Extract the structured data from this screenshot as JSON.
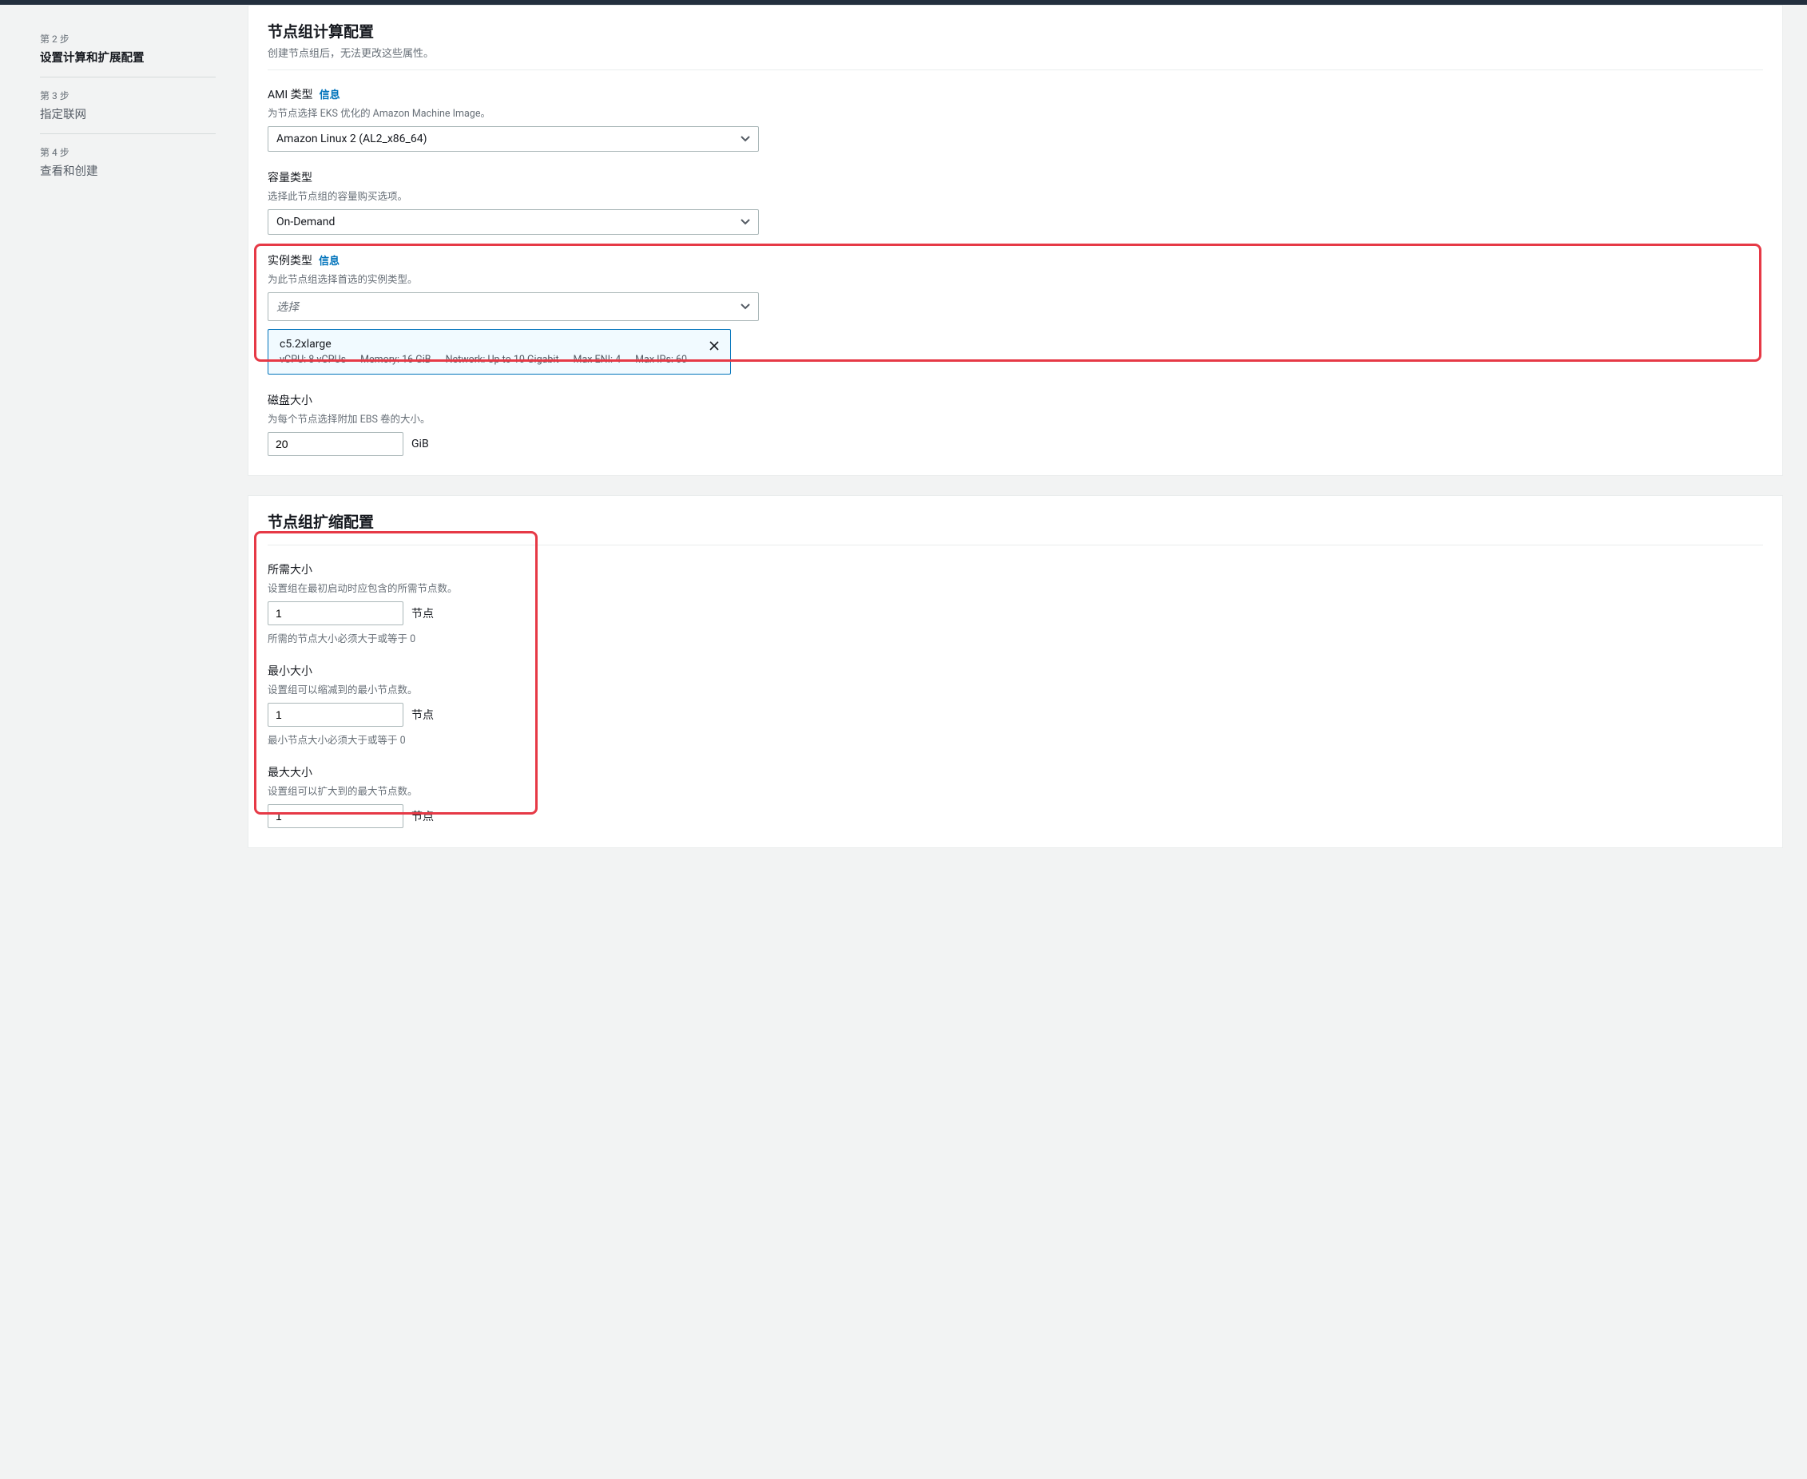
{
  "sidebar": {
    "steps": [
      {
        "num": "第 2 步",
        "label": "设置计算和扩展配置",
        "active": true
      },
      {
        "num": "第 3 步",
        "label": "指定联网",
        "active": false
      },
      {
        "num": "第 4 步",
        "label": "查看和创建",
        "active": false
      }
    ]
  },
  "compute": {
    "title": "节点组计算配置",
    "subtitle": "创建节点组后，无法更改这些属性。",
    "ami": {
      "label": "AMI 类型",
      "info": "信息",
      "desc": "为节点选择 EKS 优化的 Amazon Machine Image。",
      "value": "Amazon Linux 2 (AL2_x86_64)"
    },
    "capacity": {
      "label": "容量类型",
      "desc": "选择此节点组的容量购买选项。",
      "value": "On-Demand"
    },
    "instance": {
      "label": "实例类型",
      "info": "信息",
      "desc": "为此节点组选择首选的实例类型。",
      "placeholder": "选择",
      "selected": {
        "name": "c5.2xlarge",
        "vcpu": "vCPU: 8 vCPUs",
        "memory": "Memory: 16 GiB",
        "network": "Network: Up to 10 Gigabit",
        "maxeni": "Max ENI: 4",
        "maxips": "Max IPs: 60"
      }
    },
    "disk": {
      "label": "磁盘大小",
      "desc": "为每个节点选择附加 EBS 卷的大小。",
      "value": "20",
      "unit": "GiB"
    }
  },
  "scaling": {
    "title": "节点组扩缩配置",
    "desired": {
      "label": "所需大小",
      "desc": "设置组在最初启动时应包含的所需节点数。",
      "value": "1",
      "unit": "节点",
      "help": "所需的节点大小必须大于或等于 0"
    },
    "min": {
      "label": "最小大小",
      "desc": "设置组可以缩减到的最小节点数。",
      "value": "1",
      "unit": "节点",
      "help": "最小节点大小必须大于或等于 0"
    },
    "max": {
      "label": "最大大小",
      "desc": "设置组可以扩大到的最大节点数。",
      "value": "1",
      "unit": "节点"
    }
  }
}
